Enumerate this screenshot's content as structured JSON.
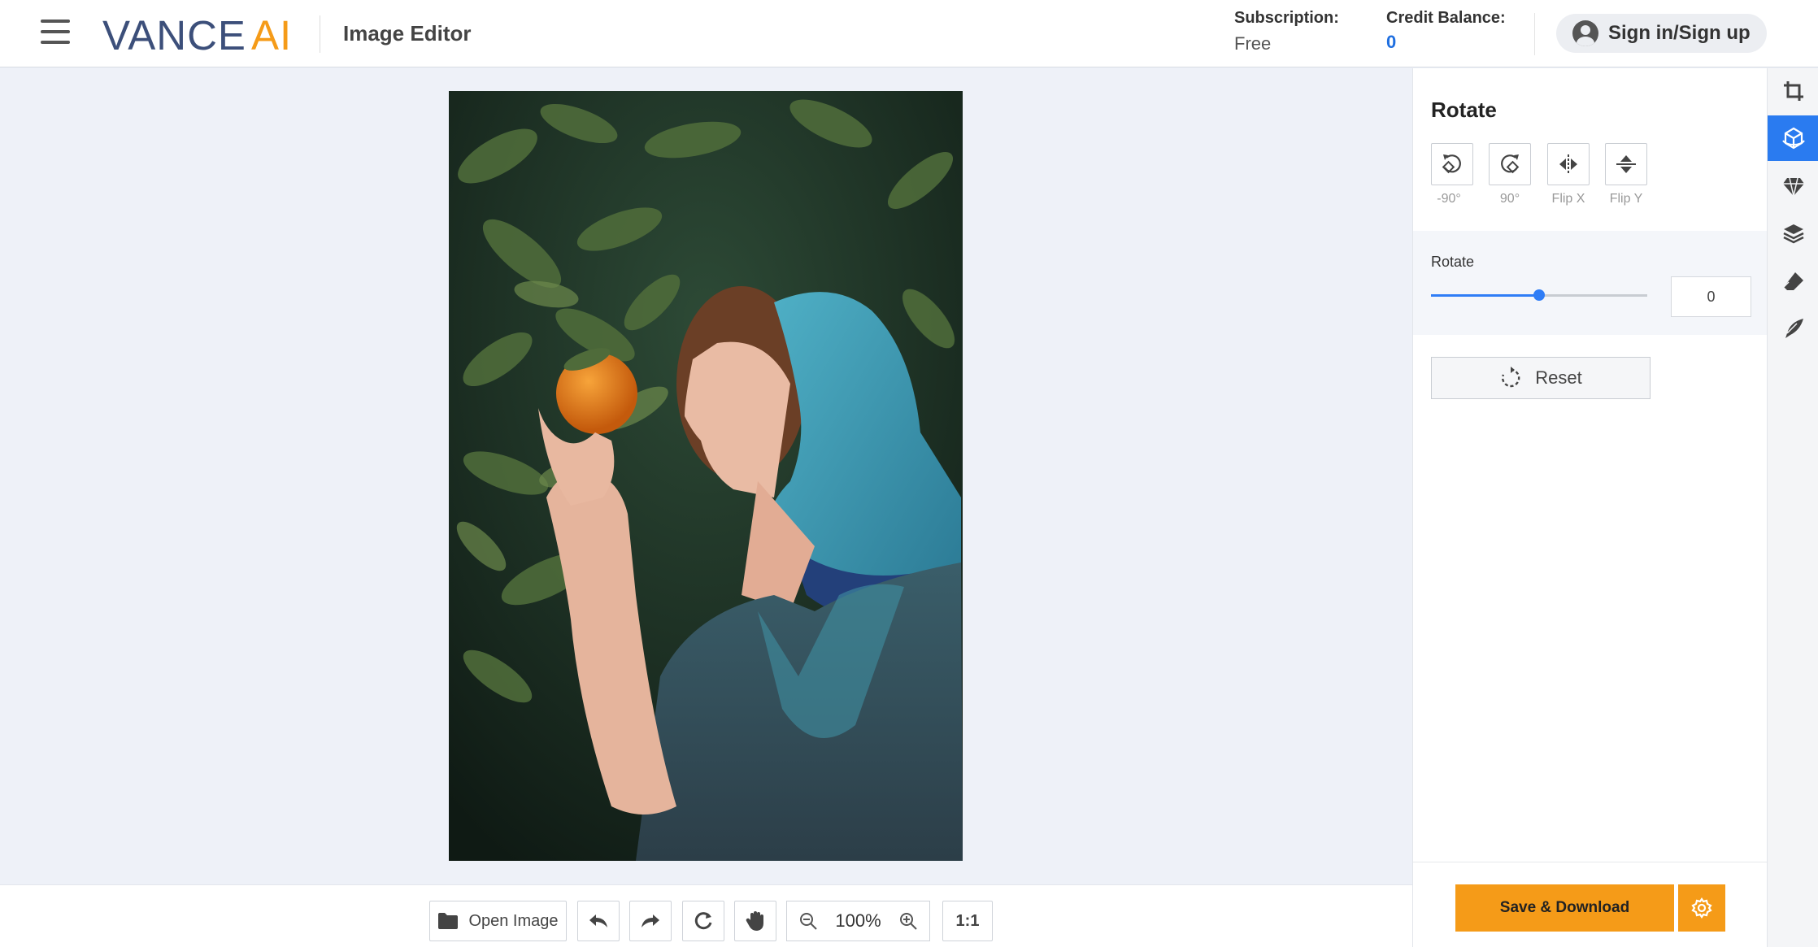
{
  "header": {
    "logo_main": "VANCE",
    "logo_accent": "AI",
    "app_title": "Image Editor",
    "subscription_label": "Subscription:",
    "subscription_value": "Free",
    "credit_label": "Credit Balance:",
    "credit_value": "0",
    "signin_label": "Sign in/Sign up"
  },
  "toolbar": {
    "open_image_label": "Open Image",
    "zoom_value": "100%",
    "actual_size_label": "1:1",
    "icons": [
      "folder-icon",
      "undo-icon",
      "redo-icon",
      "refresh-icon",
      "hand-icon",
      "zoom-out-icon",
      "zoom-in-icon"
    ]
  },
  "panel": {
    "title": "Rotate",
    "buttons": [
      {
        "label": "-90°",
        "icon": "rotate-left-icon"
      },
      {
        "label": "90°",
        "icon": "rotate-right-icon"
      },
      {
        "label": "Flip X",
        "icon": "flip-horizontal-icon"
      },
      {
        "label": "Flip Y",
        "icon": "flip-vertical-icon"
      }
    ],
    "slider_label": "Rotate",
    "slider_value_fraction": 0.5,
    "rotate_value": "0",
    "reset_label": "Reset",
    "save_label": "Save & Download"
  },
  "rail": {
    "items": [
      "crop-icon",
      "rotate-tool-icon",
      "diamond-icon",
      "layers-icon",
      "eraser-icon",
      "brush-icon"
    ],
    "active_index": 1
  },
  "colors": {
    "accent_orange": "#f59b18",
    "accent_blue": "#2a7bf0",
    "logo_navy": "#3c4f7a"
  }
}
